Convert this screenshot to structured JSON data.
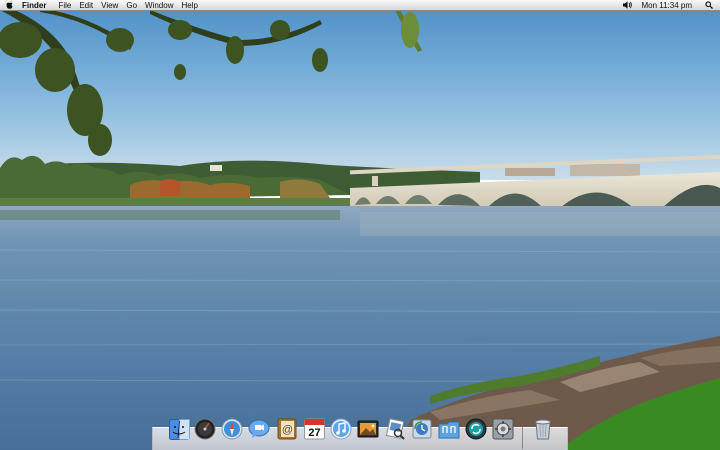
{
  "menubar": {
    "apple_icon": "apple-icon",
    "app_name": "Finder",
    "menus": [
      "File",
      "Edit",
      "View",
      "Go",
      "Window",
      "Help"
    ],
    "volume_icon": "volume-icon",
    "clock": "Mon 11:34 pm",
    "spotlight_icon": "spotlight-icon"
  },
  "dock": {
    "apps": [
      {
        "name": "Finder",
        "icon": "finder-icon"
      },
      {
        "name": "Dashboard",
        "icon": "dashboard-icon"
      },
      {
        "name": "Safari",
        "icon": "safari-icon"
      },
      {
        "name": "iChat",
        "icon": "ichat-icon"
      },
      {
        "name": "Address Book",
        "icon": "address-book-icon"
      },
      {
        "name": "iCal",
        "icon": "ical-icon",
        "badge": "27"
      },
      {
        "name": "iTunes",
        "icon": "itunes-icon"
      },
      {
        "name": "iPhoto",
        "icon": "iphoto-icon"
      },
      {
        "name": "Preview",
        "icon": "preview-icon"
      },
      {
        "name": "Time Machine",
        "icon": "time-machine-icon"
      },
      {
        "name": "Applications",
        "icon": "applications-icon"
      },
      {
        "name": "Sync",
        "icon": "sync-icon"
      },
      {
        "name": "System Preferences",
        "icon": "system-preferences-icon"
      },
      {
        "name": "Trash",
        "icon": "trash-icon"
      }
    ]
  },
  "colors": {
    "sky_top": "#4b8fc7",
    "sky_bottom": "#bfd7e8",
    "water": "#5d84a8",
    "grass": "#3a8a22"
  }
}
